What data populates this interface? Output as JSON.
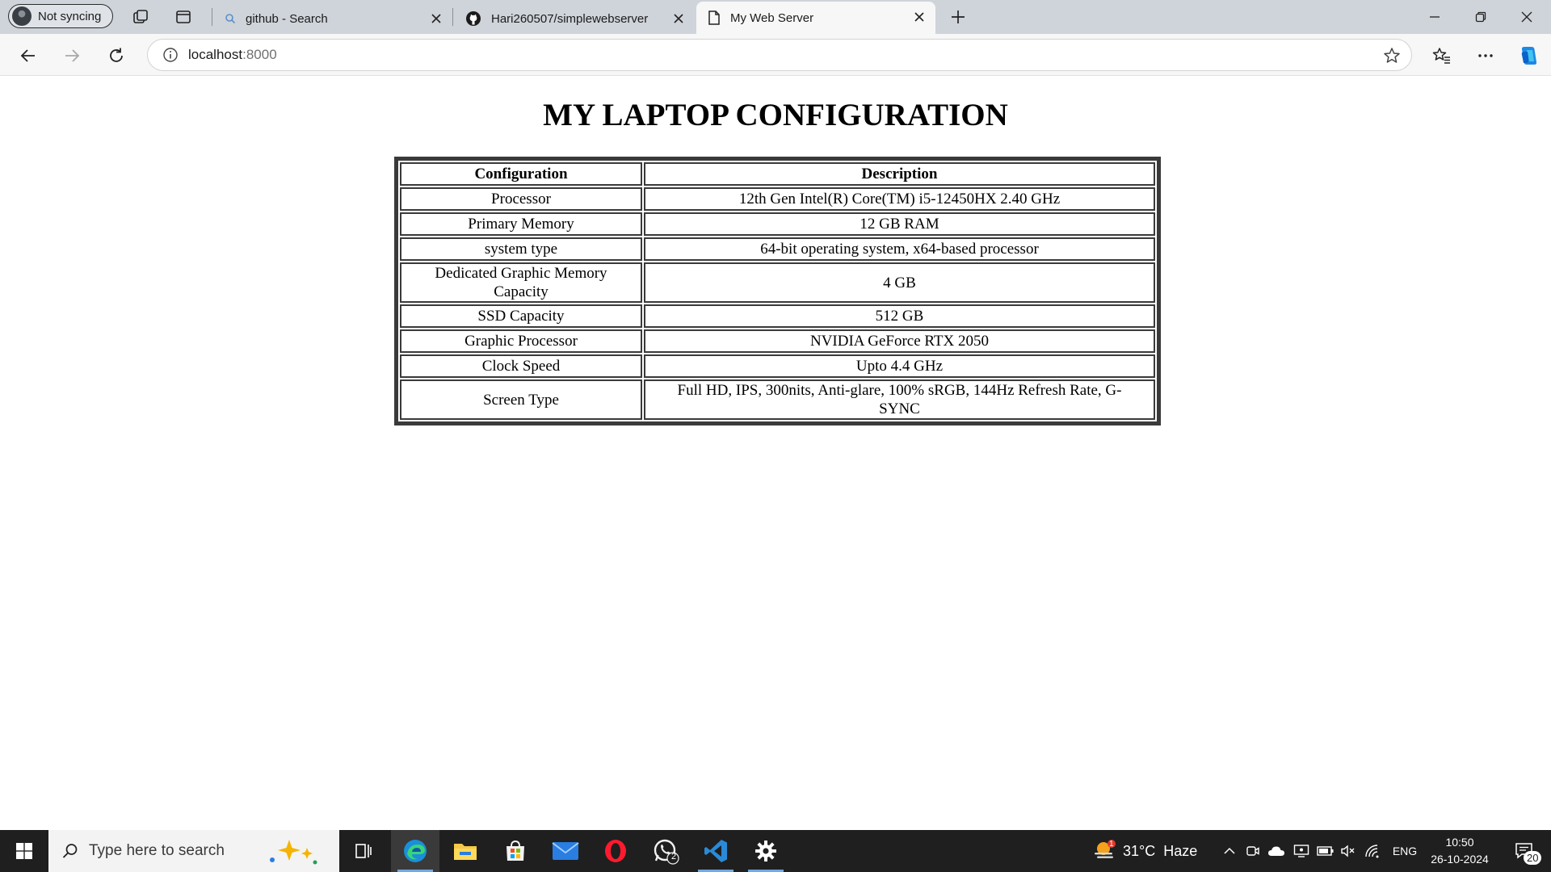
{
  "browser": {
    "profile_label": "Not syncing",
    "tabs": [
      {
        "title": "github - Search",
        "icon": "search-icon",
        "active": false
      },
      {
        "title": "Hari260507/simplewebserver",
        "icon": "github-icon",
        "active": false
      },
      {
        "title": "My Web Server",
        "icon": "document-icon",
        "active": true
      }
    ],
    "address": {
      "host": "localhost",
      "port": ":8000"
    }
  },
  "page": {
    "heading": "MY LAPTOP CONFIGURATION",
    "table": {
      "headers": [
        "Configuration",
        "Description"
      ],
      "rows": [
        [
          "Processor",
          "12th Gen Intel(R) Core(TM) i5-12450HX 2.40 GHz"
        ],
        [
          "Primary Memory",
          "12 GB RAM"
        ],
        [
          "system type",
          "64-bit operating system, x64-based processor"
        ],
        [
          "Dedicated Graphic Memory Capacity",
          "4 GB"
        ],
        [
          "SSD Capacity",
          "512 GB"
        ],
        [
          "Graphic Processor",
          "NVIDIA GeForce RTX 2050"
        ],
        [
          "Clock Speed",
          "Upto 4.4 GHz"
        ],
        [
          "Screen Type",
          "Full HD, IPS, 300nits, Anti-glare, 100% sRGB, 144Hz Refresh Rate, G-SYNC"
        ]
      ]
    }
  },
  "taskbar": {
    "search_placeholder": "Type here to search",
    "weather": "31°C  Haze",
    "weather_badge": "1",
    "language": "ENG",
    "time": "10:50",
    "date": "26-10-2024",
    "notification_count": "20",
    "whatsapp_badge": "2"
  },
  "colors": {
    "tabstrip_bg": "#cfd4da",
    "taskbar_bg": "#1f1f1f",
    "accent": "#6fa9e6",
    "table_border": "#3a3a3a"
  }
}
